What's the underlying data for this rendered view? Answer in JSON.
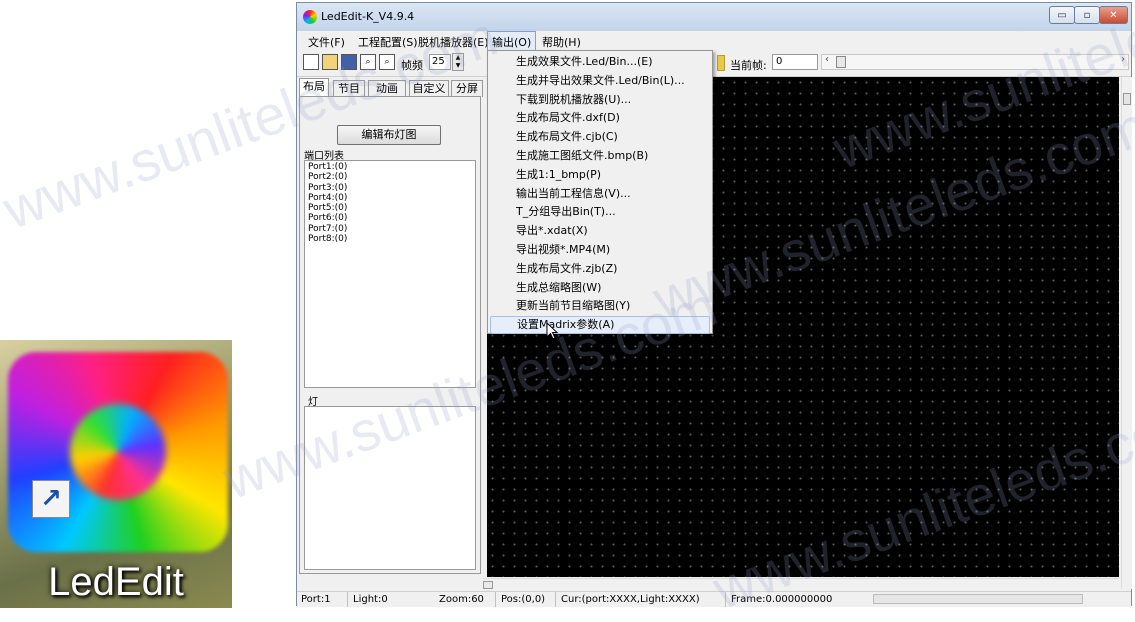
{
  "desktop_icon": {
    "label": "LedEdit"
  },
  "window": {
    "title": "LedEdit-K_V4.9.4",
    "controls": {
      "minimize": "▭",
      "maximize": "▫",
      "close": "✕"
    }
  },
  "menubar": [
    {
      "label": "文件(F)"
    },
    {
      "label": "工程配置(S)"
    },
    {
      "label": "脱机播放器(E)"
    },
    {
      "label": "输出(O)"
    },
    {
      "label": "帮助(H)"
    }
  ],
  "toolbar": {
    "fps_label": "帧频",
    "fps_value": "25",
    "current_frame_label": "当前帧:",
    "current_frame_value": "0"
  },
  "tabs": [
    {
      "label": "布局"
    },
    {
      "label": "节目"
    },
    {
      "label": "动画"
    },
    {
      "label": "自定义"
    },
    {
      "label": "分屏"
    }
  ],
  "left_panel": {
    "edit_layout_button": "编辑布灯图",
    "port_list_title": "端口列表",
    "ports": [
      "Port1:(0)",
      "Port2:(0)",
      "Port3:(0)",
      "Port4:(0)",
      "Port5:(0)",
      "Port6:(0)",
      "Port7:(0)",
      "Port8:(0)"
    ],
    "light_title": "灯"
  },
  "output_menu": {
    "items": [
      "生成效果文件.Led/Bin...(E)",
      "生成并导出效果文件.Led/Bin(L)...",
      "下载到脱机播放器(U)...",
      "生成布局文件.dxf(D)",
      "生成布局文件.cjb(C)",
      "生成施工图纸文件.bmp(B)",
      "生成1:1_bmp(P)",
      "输出当前工程信息(V)...",
      "T_分组导出Bin(T)...",
      "导出*.xdat(X)",
      "导出视频*.MP4(M)",
      "生成布局文件.zjb(Z)",
      "生成总缩略图(W)",
      "更新当前节目缩略图(Y)",
      "设置Madrix参数(A)"
    ],
    "hovered_index": 14
  },
  "statusbar": {
    "port": "Port:1",
    "light": "Light:0",
    "zoom": "Zoom:60",
    "pos": "Pos:(0,0)",
    "cur": "Cur:(port:XXXX,Light:XXXX)",
    "frame": "Frame:0.000000000"
  },
  "watermark": "www.sunliteleds.com",
  "colors": {
    "canvas_bg": "#000000",
    "menu_hover": "#e6eef9",
    "title_bar": "#c3d4ea"
  }
}
